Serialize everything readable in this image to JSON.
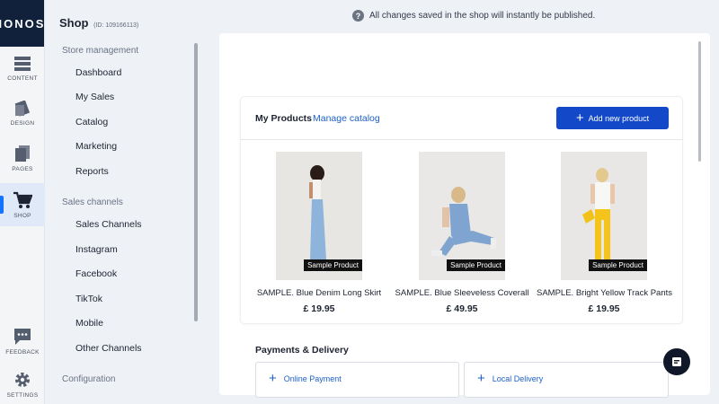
{
  "brand": {
    "logo": "IONOS"
  },
  "rail": [
    {
      "label": "CONTENT",
      "icon": "content-icon"
    },
    {
      "label": "DESIGN",
      "icon": "design-icon"
    },
    {
      "label": "PAGES",
      "icon": "pages-icon"
    },
    {
      "label": "SHOP",
      "icon": "shop-cart-icon",
      "active": true
    },
    {
      "label": "FEEDBACK",
      "icon": "feedback-icon"
    },
    {
      "label": "SETTINGS",
      "icon": "settings-gear-icon"
    }
  ],
  "sidebar": {
    "title": "Shop",
    "shop_id": "(ID: 109166113)",
    "sections": [
      {
        "label": "Store management",
        "items": [
          "Dashboard",
          "My Sales",
          "Catalog",
          "Marketing",
          "Reports"
        ]
      },
      {
        "label": "Sales channels",
        "items": [
          "Sales Channels",
          "Instagram",
          "Facebook",
          "TikTok",
          "Mobile",
          "Other Channels"
        ]
      },
      {
        "label": "Configuration",
        "items": []
      }
    ]
  },
  "notice": {
    "icon": "help-question-icon",
    "text": "All changes saved in the shop will instantly be published."
  },
  "products_card": {
    "title": "My Products",
    "manage_link": "Manage catalog",
    "add_button": "Add new product",
    "badge": "Sample Product",
    "products": [
      {
        "name": "SAMPLE. Blue Denim Long Skirt",
        "price": "£ 19.95"
      },
      {
        "name": "SAMPLE. Blue Sleeveless Coverall",
        "price": "£ 49.95"
      },
      {
        "name": "SAMPLE. Bright Yellow Track Pants",
        "price": "£ 19.95"
      }
    ]
  },
  "payments": {
    "title": "Payments & Delivery",
    "options": [
      "Online Payment",
      "Local Delivery"
    ]
  },
  "colors": {
    "accent": "#1349c9",
    "link": "#1d60c9",
    "logo_bg": "#11203b"
  }
}
